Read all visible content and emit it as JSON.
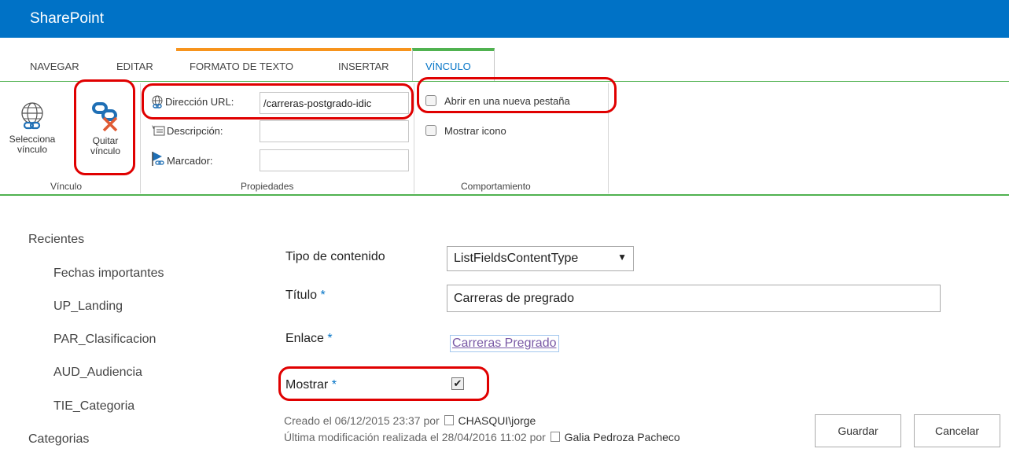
{
  "app": {
    "brand": "SharePoint"
  },
  "ribbon_tabs": {
    "navegar": "NAVEGAR",
    "editar": "EDITAR",
    "formato": "FORMATO DE TEXTO",
    "insertar": "INSERTAR",
    "vinculo": "VÍNCULO"
  },
  "ribbon": {
    "vinculo_group": {
      "select_btn_line1": "Selecciona",
      "select_btn_line2": "vínculo",
      "remove_btn_line1": "Quitar",
      "remove_btn_line2": "vínculo",
      "label": "Vínculo"
    },
    "propiedades_group": {
      "url_label": "Dirección URL:",
      "url_value": "/carreras-postgrado-idic",
      "descripcion_label": "Descripción:",
      "marcador_label": "Marcador:",
      "label": "Propiedades"
    },
    "comportamiento_group": {
      "open_new_tab": "Abrir en una nueva pestaña",
      "show_icon": "Mostrar icono",
      "label": "Comportamiento"
    }
  },
  "nav": {
    "recientes": "Recientes",
    "items": [
      "Fechas importantes",
      "UP_Landing",
      "PAR_Clasificacion",
      "AUD_Audiencia",
      "TIE_Categoria"
    ],
    "categorias": "Categorias"
  },
  "form": {
    "tipo_label": "Tipo de contenido",
    "tipo_value": "ListFieldsContentType",
    "titulo_label": "Título",
    "titulo_value": "Carreras de pregrado",
    "enlace_label": "Enlace",
    "enlace_value": "Carreras Pregrado",
    "mostrar_label": "Mostrar",
    "mostrar_checked": true,
    "required_mark": "*"
  },
  "meta": {
    "created_prefix": "Creado el 06/12/2015 23:37  por",
    "created_user": "CHASQUI\\jorge",
    "modified_prefix": "Última modificación realizada el 28/04/2016 11:02  por",
    "modified_user": "Galia Pedroza Pacheco"
  },
  "buttons": {
    "save": "Guardar",
    "cancel": "Cancelar"
  },
  "colors": {
    "brand": "#0072c6",
    "accent_green": "#50b250",
    "accent_orange": "#f7941d",
    "highlight_red": "#e00000"
  }
}
